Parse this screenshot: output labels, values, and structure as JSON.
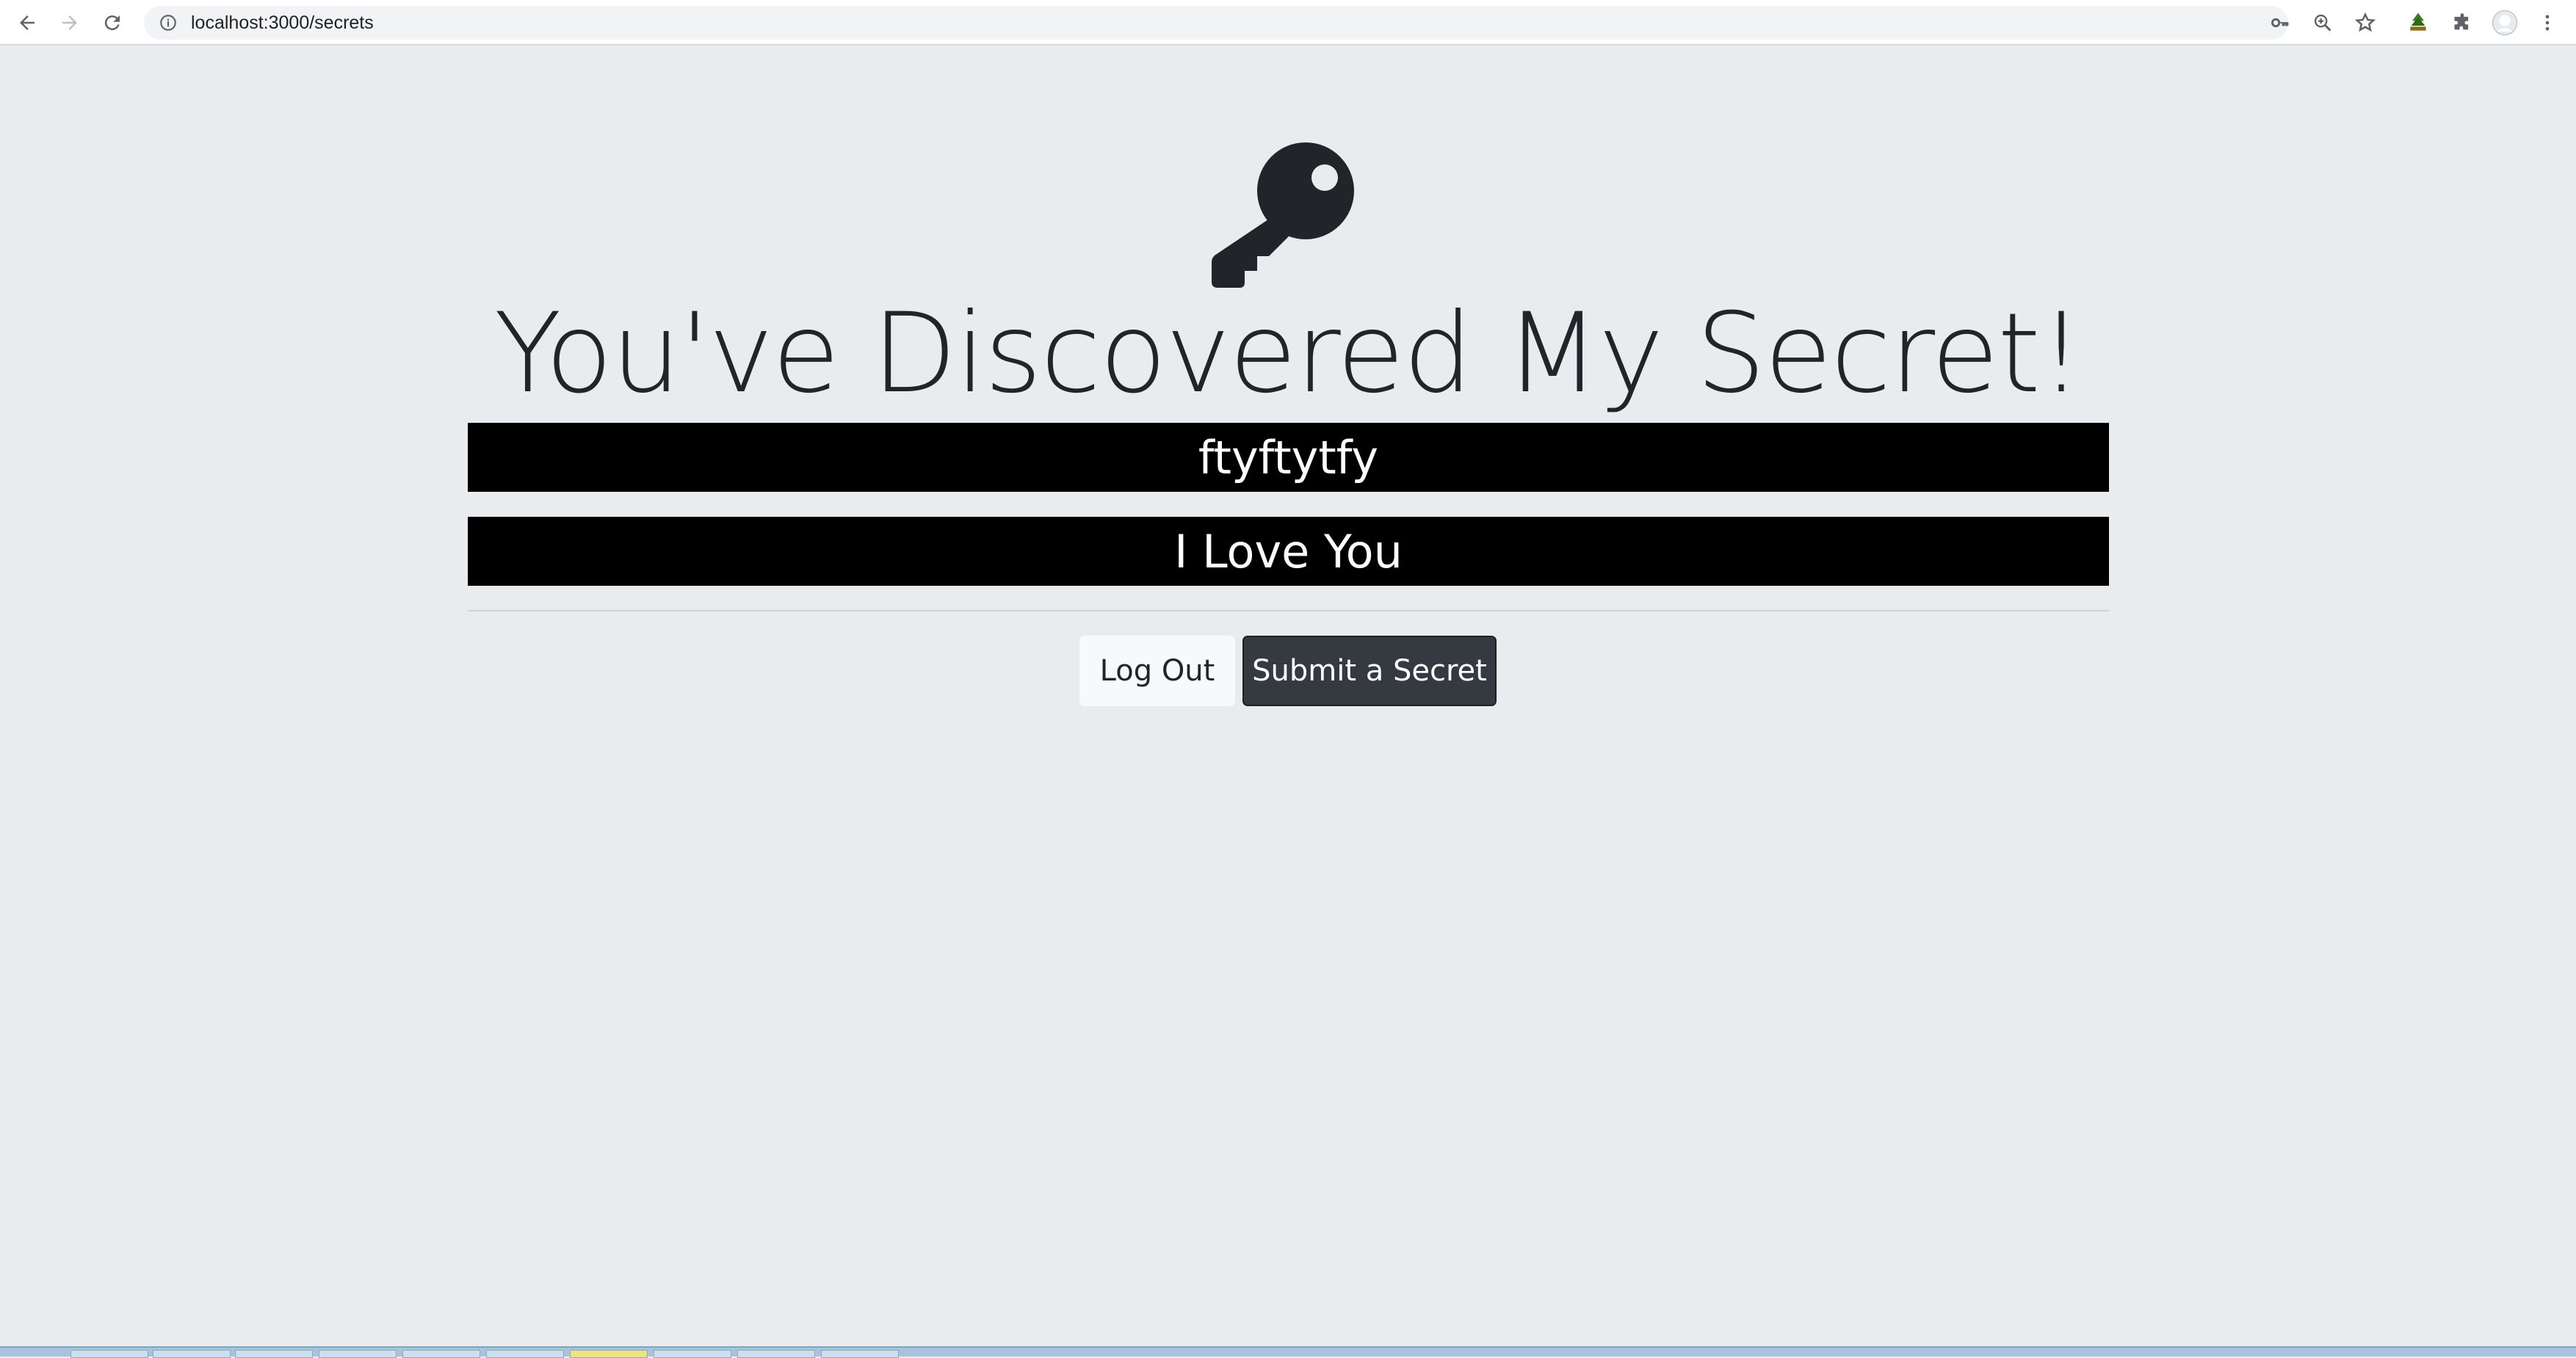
{
  "browser": {
    "url": "localhost:3000/secrets",
    "icons": [
      "back-icon",
      "forward-icon",
      "reload-icon",
      "site-info-icon",
      "key-icon",
      "zoom-icon",
      "bookmark-star-icon",
      "extension-icon",
      "puzzle-icon",
      "profile-icon",
      "menu-icon"
    ]
  },
  "page": {
    "title": "You've Discovered My Secret!",
    "secrets": [
      "ftyftytfy",
      "I Love You"
    ],
    "logout_label": "Log Out",
    "submit_label": "Submit a Secret"
  },
  "colors": {
    "background": "#e9ecef",
    "secret_bg": "#000000",
    "dark_button": "#343a40",
    "light_button": "#f8f9fa"
  }
}
